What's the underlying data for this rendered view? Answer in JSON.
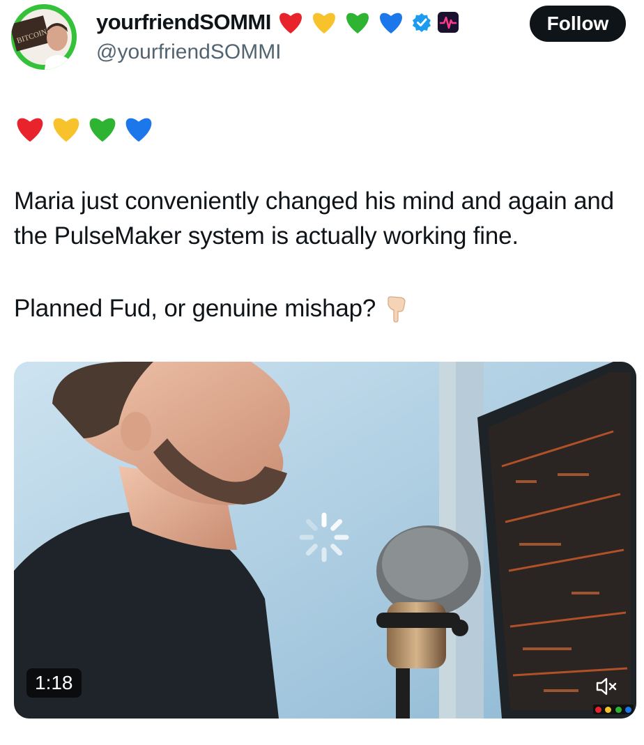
{
  "tweet": {
    "display_name": "yourfriendSOMMI",
    "handle": "@yourfriendSOMMI",
    "follow_label": "Follow",
    "paragraph_1": "Maria just conveniently changed his mind and again and the PulseMaker system is actually working fine.",
    "paragraph_2": "Planned Fud, or genuine mishap?",
    "avatar_text": "BITCOIN"
  },
  "video": {
    "duration": "1:18"
  },
  "icons": {
    "hearts": [
      "red-heart-icon",
      "yellow-heart-icon",
      "green-heart-icon",
      "blue-heart-icon"
    ],
    "verified": "verified-badge-icon",
    "pointing": "pointing-down-icon",
    "mute": "volume-muted-icon",
    "loading": "loading-spinner-icon"
  },
  "colors": {
    "red_heart": "#e8232c",
    "yellow_heart": "#f7c22c",
    "green_heart": "#2fb332",
    "blue_heart": "#1c78ea",
    "verified": "#1d9bf0",
    "follow_bg": "#0f1419",
    "handle_text": "#536471"
  }
}
